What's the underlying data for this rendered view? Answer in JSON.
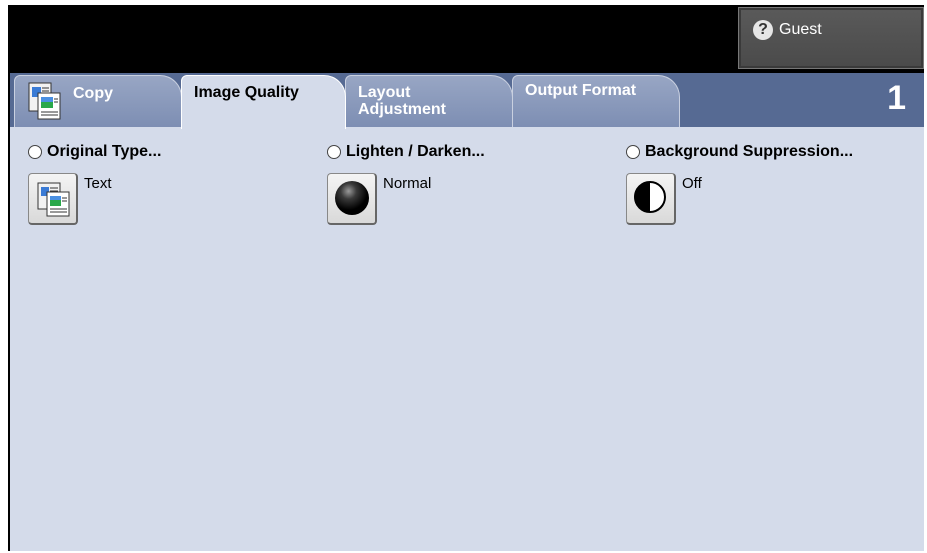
{
  "header": {
    "guest_label": "Guest",
    "guest_icon": "question-icon",
    "guest_glyph": "?"
  },
  "tabs": [
    {
      "label": "Copy",
      "icon": "copy-documents-icon",
      "active": false
    },
    {
      "label": "Image Quality",
      "active": true
    },
    {
      "label": "Layout\nAdjustment",
      "active": false
    },
    {
      "label": "Output Format",
      "active": false
    }
  ],
  "page_number": "1",
  "options": [
    {
      "title": "Original Type...",
      "value": "Text",
      "icon": "document-image-icon"
    },
    {
      "title": "Lighten / Darken...",
      "value": "Normal",
      "icon": "dark-sphere-icon"
    },
    {
      "title": "Background Suppression...",
      "value": "Off",
      "icon": "half-circle-icon"
    }
  ],
  "colors": {
    "tab_bar": "#566a93",
    "panel": "#d4dbea",
    "screen": "#000000"
  }
}
